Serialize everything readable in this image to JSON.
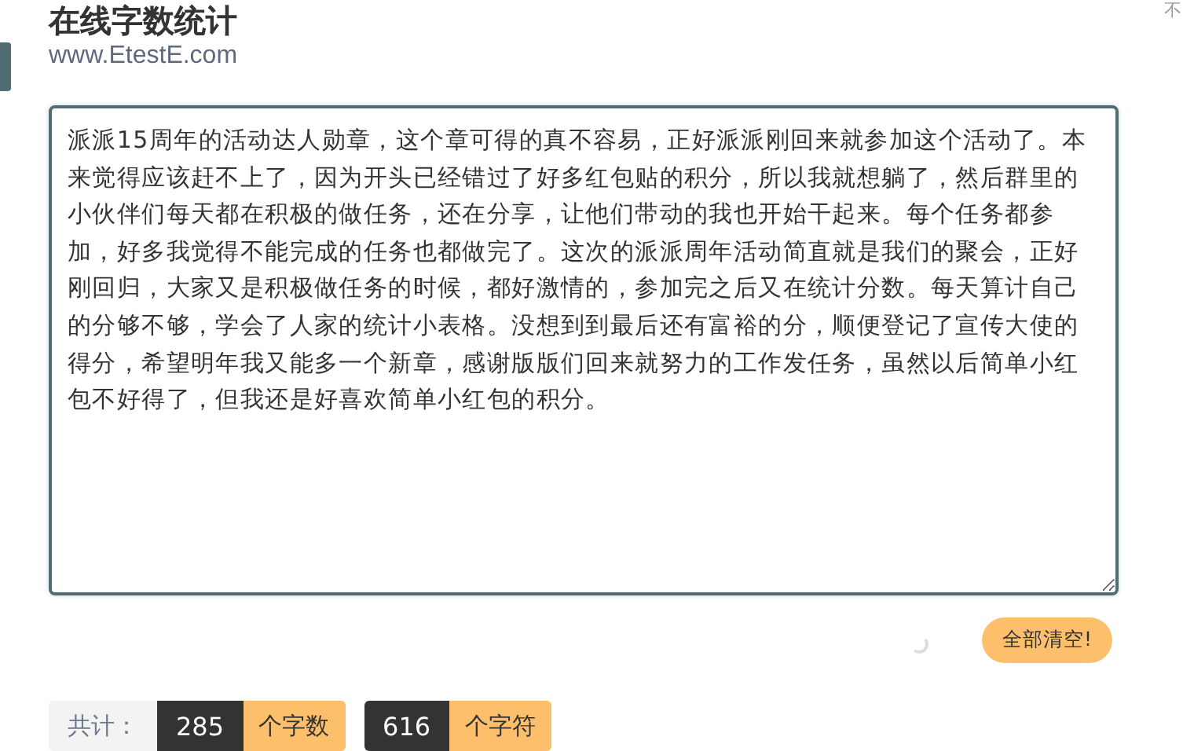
{
  "header": {
    "title": "在线字数统计",
    "url": "www.EtestE.com",
    "corner_text": "不"
  },
  "editor": {
    "text": "派派15周年的活动达人勋章，这个章可得的真不容易，正好派派刚回来就参加这个活动了。本来觉得应该赶不上了，因为开头已经错过了好多红包贴的积分，所以我就想躺了，然后群里的小伙伴们每天都在积极的做任务，还在分享，让他们带动的我也开始干起来。每个任务都参加，好多我觉得不能完成的任务也都做完了。这次的派派周年活动简直就是我们的聚会，正好刚回归，大家又是积极做任务的时候，都好激情的，参加完之后又在统计分数。每天算计自己的分够不够，学会了人家的统计小表格。没想到到最后还有富裕的分，顺便登记了宣传大使的得分，希望明年我又能多一个新章，感谢版版们回来就努力的工作发任务，虽然以后简单小红包不好得了，但我还是好喜欢简单小红包的积分。"
  },
  "clear_button": {
    "label": "全部清空!"
  },
  "stats": {
    "label": "共计：",
    "counts": [
      {
        "value": "285",
        "unit": "个字数"
      },
      {
        "value": "616",
        "unit": "个字符"
      }
    ]
  }
}
